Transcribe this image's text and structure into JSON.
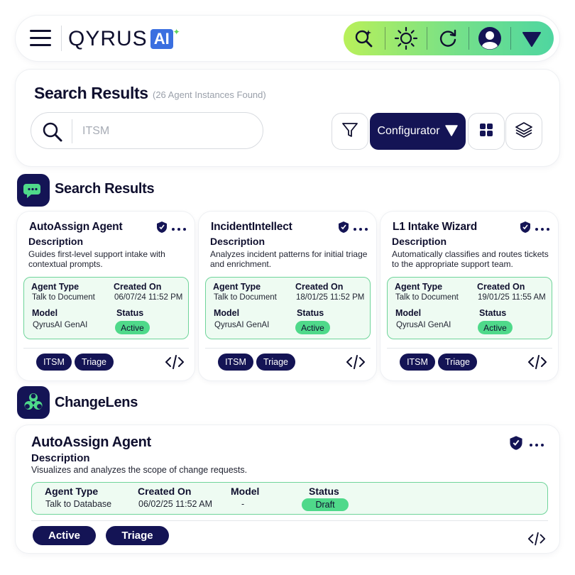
{
  "header": {
    "logo_text": "QYRUS",
    "logo_badge": "AI",
    "toolbar_icons": [
      "ai-search-icon",
      "sun-icon",
      "refresh-icon",
      "user-avatar-icon",
      "chevron-down-icon"
    ],
    "brand_gradient": [
      "#b9f05a",
      "#4fd6a0"
    ]
  },
  "search_panel": {
    "title": "Search Results",
    "count": "(26 Agent Instances Found)",
    "search_value": "",
    "search_placeholder": "ITSM",
    "configurator_label": "Configurator"
  },
  "section1": {
    "title": "Search Results"
  },
  "cards": [
    {
      "name": "AutoAssign Agent",
      "description_label": "Description",
      "description": "Guides first-level support intake with contextual prompts.",
      "agent_type_label": "Agent Type",
      "agent_type": "Talk to Document",
      "created_on_label": "Created On",
      "created_on": "06/07/24 11:52 PM",
      "model_label": "Model",
      "model": "QyrusAI GenAI",
      "status_label": "Status",
      "status": "Active",
      "tags": [
        "ITSM",
        "Triage"
      ]
    },
    {
      "name": "IncidentIntellect",
      "description_label": "Description",
      "description": "Analyzes incident patterns for initial triage and enrichment.",
      "agent_type_label": "Agent Type",
      "agent_type": "Talk to Document",
      "created_on_label": "Created On",
      "created_on": "18/01/25 11:52 PM",
      "model_label": "Model",
      "model": "QyrusAI GenAI",
      "status_label": "Status",
      "status": "Active",
      "tags": [
        "ITSM",
        "Triage"
      ]
    },
    {
      "name": "L1 Intake Wizard",
      "description_label": "Description",
      "description": "Automatically classifies and routes tickets to the appropriate support team.",
      "agent_type_label": "Agent Type",
      "agent_type": "Talk to Document",
      "created_on_label": "Created On",
      "created_on": "19/01/25 11:55 AM",
      "model_label": "Model",
      "model": "QyrusAI GenAI",
      "status_label": "Status",
      "status": "Active",
      "tags": [
        "ITSM",
        "Triage"
      ]
    }
  ],
  "section2": {
    "title": "ChangeLens"
  },
  "wide_card": {
    "name": "AutoAssign Agent",
    "description_label": "Description",
    "description": "Visualizes and analyzes the scope of change requests.",
    "agent_type_label": "Agent Type",
    "agent_type": "Talk to Database",
    "created_on_label": "Created On",
    "created_on": "06/02/25 11:52 AM",
    "model_label": "Model",
    "model": "-",
    "status_label": "Status",
    "status": "Draft",
    "tags": [
      "Active",
      "Triage"
    ]
  },
  "colors": {
    "navy": "#141455",
    "status_green": "#4fd98a",
    "info_bg": "#eefbf2",
    "info_border": "#6fd49a"
  }
}
